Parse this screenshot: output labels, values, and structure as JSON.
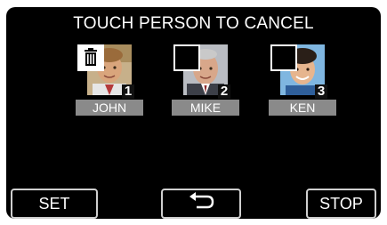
{
  "screen": {
    "title": "TOUCH PERSON TO CANCEL"
  },
  "people": [
    {
      "number": "1",
      "name": "JOHN",
      "state": "trash-icon"
    },
    {
      "number": "2",
      "name": "MIKE",
      "state": "empty-checkbox"
    },
    {
      "number": "3",
      "name": "KEN",
      "state": "empty-checkbox"
    }
  ],
  "buttons": {
    "set": "SET",
    "back_icon": "return-arrow-icon",
    "stop": "STOP"
  },
  "colors": {
    "panel_bg": "#000000",
    "name_bar": "#8a8a8a",
    "button_border": "#cfcfcf"
  }
}
